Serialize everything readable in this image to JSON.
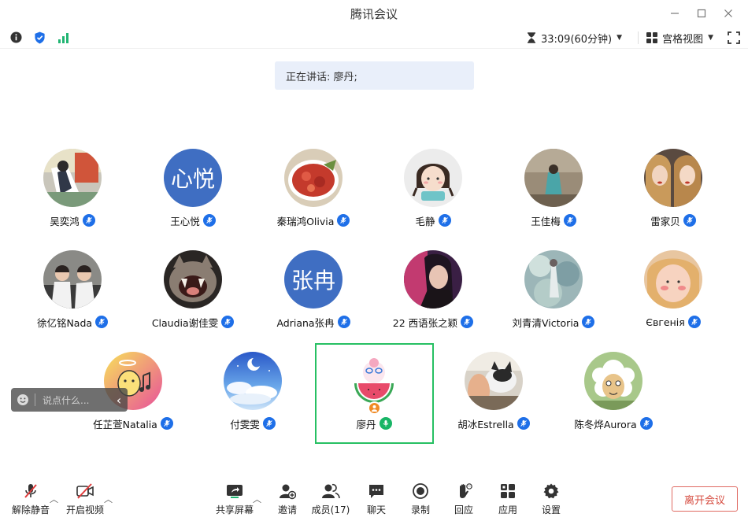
{
  "window": {
    "title": "腾讯会议"
  },
  "infobar": {
    "icons": [
      "info-icon",
      "shield-check-icon",
      "signal-icon"
    ],
    "timer": "33:09(60分钟)",
    "view_mode": "宫格视图"
  },
  "speaking": {
    "text": "正在讲话: 廖丹;"
  },
  "participants": [
    {
      "name": "吴奕鸿"
    },
    {
      "name": "王心悦",
      "initials": "心悦"
    },
    {
      "name": "秦瑞鸿Olivia"
    },
    {
      "name": "毛静"
    },
    {
      "name": "王佳梅"
    },
    {
      "name": "雷家贝"
    },
    {
      "name": "徐亿铭Nada"
    },
    {
      "name": "Claudia谢佳雯"
    },
    {
      "name": "Adriana张冉",
      "initials": "张冉"
    },
    {
      "name": "22 西语张之颖"
    },
    {
      "name": "刘青清Victoria"
    },
    {
      "name": "Євгенія"
    },
    {
      "name": "任芷萱Natalia"
    },
    {
      "name": "付雯雯"
    },
    {
      "name": "廖丹",
      "speaking": true
    },
    {
      "name": "胡冰Estrella"
    },
    {
      "name": "陈冬烨Aurora"
    }
  ],
  "chat": {
    "placeholder": "说点什么..."
  },
  "toolbar": {
    "unmute": "解除静音",
    "start_video": "开启视频",
    "share_screen": "共享屏幕",
    "invite": "邀请",
    "members": "成员(17)",
    "chat": "聊天",
    "record": "录制",
    "reaction": "回应",
    "apps": "应用",
    "settings": "设置",
    "leave": "离开会议"
  },
  "colors": {
    "accent": "#1e6fe8",
    "active": "#27c063",
    "leave": "#d64b3f",
    "initials_bg": "#3f6ec2"
  }
}
